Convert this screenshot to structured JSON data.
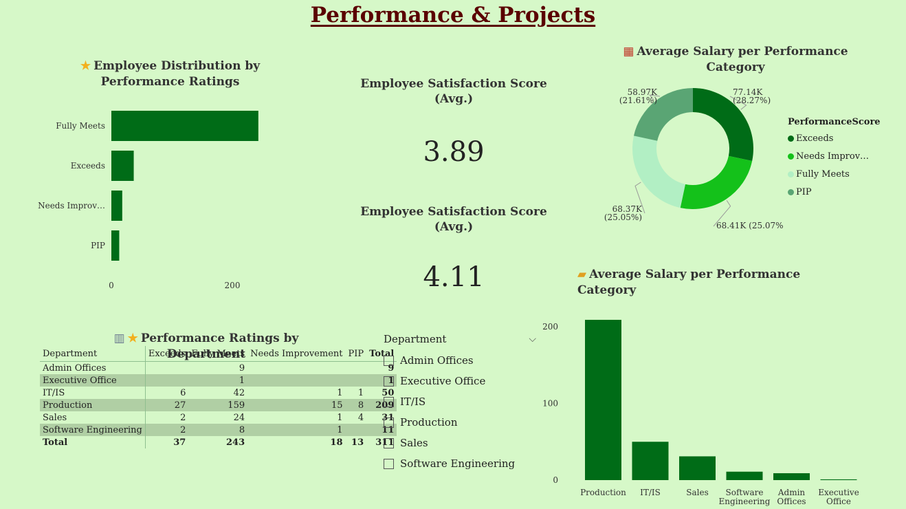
{
  "page": {
    "title": "Performance & Projects"
  },
  "colors": {
    "bar": "#006c17",
    "background": "#d6f8c8",
    "title": "#5a0000"
  },
  "distribution_chart": {
    "title": "Employee Distribution by Performance Ratings",
    "icon": "star-icon"
  },
  "cards": [
    {
      "title": "Employee Satisfaction Score (Avg.)",
      "value": "3.89"
    },
    {
      "title": "Employee Satisfaction Score (Avg.)",
      "value": "4.11"
    }
  ],
  "donut_chart": {
    "title": "Average Salary per Performance Category",
    "icon": "abacus-icon",
    "legend_title": "PerformanceScore",
    "legend": [
      {
        "label": "Exceeds",
        "color": "#006c17"
      },
      {
        "label": "Needs Improv…",
        "color": "#14c11a"
      },
      {
        "label": "Fully Meets",
        "color": "#b2efc4"
      },
      {
        "label": "PIP",
        "color": "#5aa574"
      }
    ],
    "labels": [
      {
        "line1": "77.14K",
        "line2": "(28.27%)"
      },
      {
        "line1": "68.41K (25.07%)",
        "line2": ""
      },
      {
        "line1": "68.37K",
        "line2": "(25.05%)"
      },
      {
        "line1": "58.97K",
        "line2": "(21.61%)"
      }
    ]
  },
  "column_chart": {
    "title": "Average Salary per Performance Category",
    "icon": "folder-icon"
  },
  "table": {
    "title": "Performance Ratings by Department",
    "icons": [
      "office-building-icon",
      "star-icon"
    ],
    "headers": [
      "Department",
      "Exceeds",
      "Fully Meets",
      "Needs Improvement",
      "PIP",
      "Total"
    ],
    "rows": [
      [
        "Admin Offices",
        "",
        "9",
        "",
        "",
        "9"
      ],
      [
        "Executive Office",
        "",
        "1",
        "",
        "",
        "1"
      ],
      [
        "IT/IS",
        "6",
        "42",
        "1",
        "1",
        "50"
      ],
      [
        "Production",
        "27",
        "159",
        "15",
        "8",
        "209"
      ],
      [
        "Sales",
        "2",
        "24",
        "1",
        "4",
        "31"
      ],
      [
        "Software Engineering",
        "2",
        "8",
        "1",
        "",
        "11"
      ]
    ],
    "totals": [
      "Total",
      "37",
      "243",
      "18",
      "13",
      "311"
    ]
  },
  "slicer": {
    "title": "Department",
    "items": [
      "Admin Offices",
      "Executive Office",
      "IT/IS",
      "Production",
      "Sales",
      "Software Engineering"
    ]
  },
  "chart_data": [
    {
      "type": "bar",
      "orientation": "horizontal",
      "title": "Employee Distribution by Performance Ratings",
      "categories": [
        "Fully Meets",
        "Exceeds",
        "Needs Improv…",
        "PIP"
      ],
      "values": [
        243,
        37,
        18,
        13
      ],
      "xticks": [
        "0",
        "200"
      ],
      "xlim": [
        0,
        280
      ]
    },
    {
      "type": "pie",
      "title": "Average Salary per Performance Category",
      "categories": [
        "Exceeds",
        "Needs Improv…",
        "Fully Meets",
        "PIP"
      ],
      "values": [
        77.14,
        68.41,
        68.37,
        58.97
      ],
      "percentages": [
        28.27,
        25.07,
        25.05,
        21.61
      ]
    },
    {
      "type": "bar",
      "orientation": "vertical",
      "title": "Average Salary per Performance Category",
      "categories": [
        [
          "Production"
        ],
        [
          "IT/IS"
        ],
        [
          "Sales"
        ],
        [
          "Software",
          "Engineering"
        ],
        [
          "Admin",
          "Offices"
        ],
        [
          "Executive",
          "Office"
        ]
      ],
      "values": [
        209,
        50,
        31,
        11,
        9,
        1
      ],
      "yticks": [
        "0",
        "100",
        "200"
      ],
      "ylim": [
        0,
        220
      ]
    }
  ]
}
